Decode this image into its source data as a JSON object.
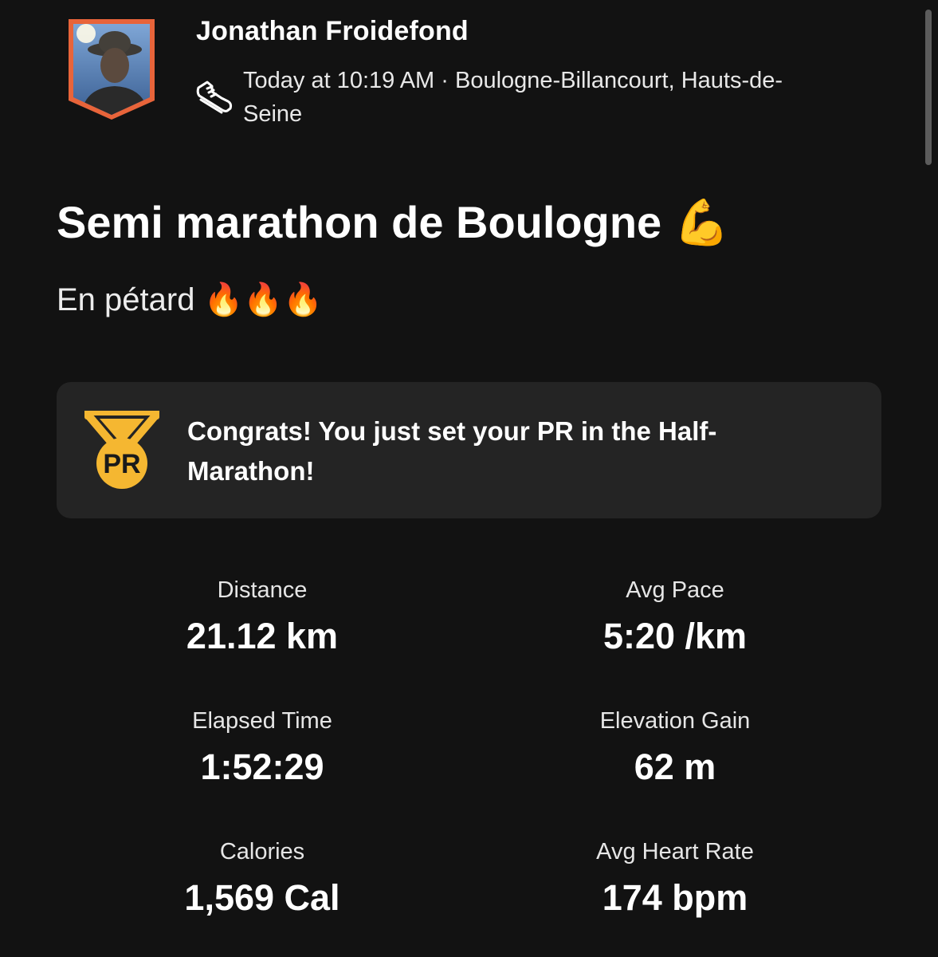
{
  "header": {
    "athlete_name": "Jonathan Froidefond",
    "meta": "Today at 10:19 AM · Boulogne-Billancourt, Hauts-de-Seine",
    "activity_icon": "running-shoe-icon",
    "avatar_frame_color": "#e8643a"
  },
  "activity": {
    "title": "Semi marathon de Boulogne 💪",
    "description": "En pétard 🔥🔥🔥"
  },
  "pr_banner": {
    "text": "Congrats! You just set your PR in the Half-Marathon!",
    "badge_label": "PR",
    "badge_color": "#f5b731",
    "icon": "pr-medal-icon"
  },
  "stats": [
    {
      "label": "Distance",
      "value": "21.12 km"
    },
    {
      "label": "Avg Pace",
      "value": "5:20 /km"
    },
    {
      "label": "Elapsed Time",
      "value": "1:52:29"
    },
    {
      "label": "Elevation Gain",
      "value": "62 m"
    },
    {
      "label": "Calories",
      "value": "1,569 Cal"
    },
    {
      "label": "Avg Heart Rate",
      "value": "174 bpm"
    }
  ]
}
